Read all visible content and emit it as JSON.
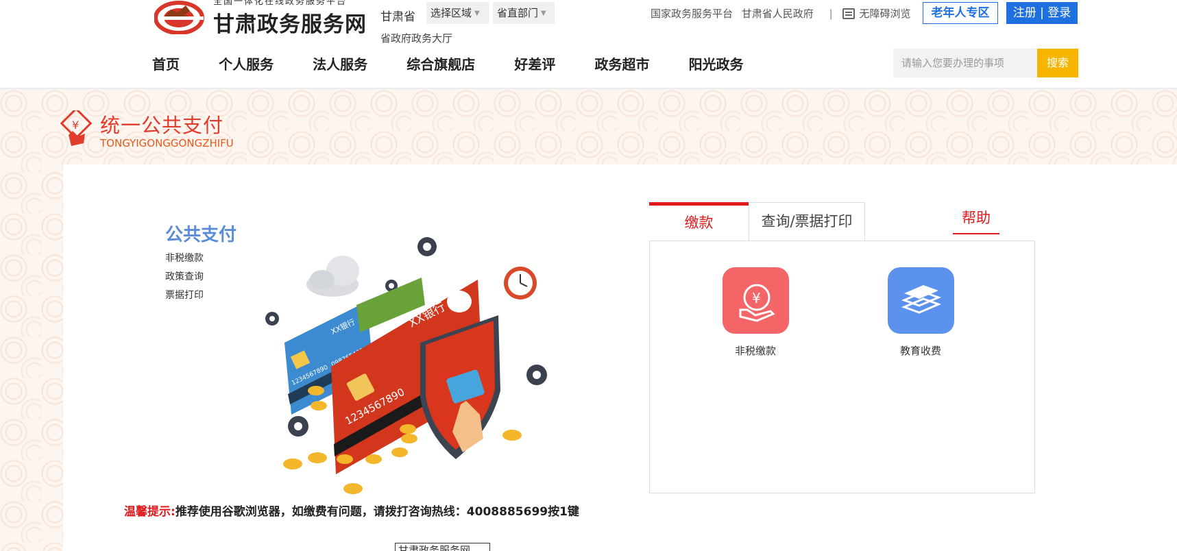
{
  "header": {
    "logo_subtitle": "全国一体化在线政务服务平台",
    "logo_title": "甘肃政务服务网",
    "region_label": "甘肃省",
    "region_select": "选择区域",
    "dept_select": "省直部门",
    "hall_link": "省政府政务大厅",
    "top_links": {
      "national": "国家政务服务平台",
      "province": "甘肃省人民政府",
      "separator": "|",
      "accessible": "无障碍浏览"
    },
    "elder_button": "老年人专区",
    "register_login": "注册 | 登录",
    "nav": [
      "首页",
      "个人服务",
      "法人服务",
      "综合旗舰店",
      "好差评",
      "政务超市",
      "阳光政务"
    ],
    "search_placeholder": "请输入您要办理的事项",
    "search_button": "搜索"
  },
  "section": {
    "title": "统一公共支付",
    "subtitle": "TONGYIGONGGONGZHIFU"
  },
  "left": {
    "title": "公共支付",
    "items": [
      "非税缴款",
      "政策查询",
      "票据打印"
    ],
    "illustration_texts": {
      "bank_big": "XX银行",
      "bank_small": "XX银行",
      "card_num_big": "1234567890",
      "card_num_small": "1234567890",
      "card_num_small2": "0987654321"
    },
    "tip_label": "温馨提示:",
    "tip_text": "推荐使用谷歌浏览器，如缴费有问题，请拨打咨询热线：4008885699按1键",
    "footer_box": "甘肃政务服务网"
  },
  "tabs": {
    "active": "缴款",
    "inactive": "查询/票据打印",
    "help": "帮助"
  },
  "services": [
    {
      "label": "非税缴款",
      "icon": "yen-hand-icon",
      "color": "#f36567"
    },
    {
      "label": "教育收费",
      "icon": "books-icon",
      "color": "#5b92ee"
    }
  ],
  "colors": {
    "brand_red": "#e0191c",
    "brand_blue": "#1e6fe0",
    "search_yellow": "#f8b500"
  }
}
